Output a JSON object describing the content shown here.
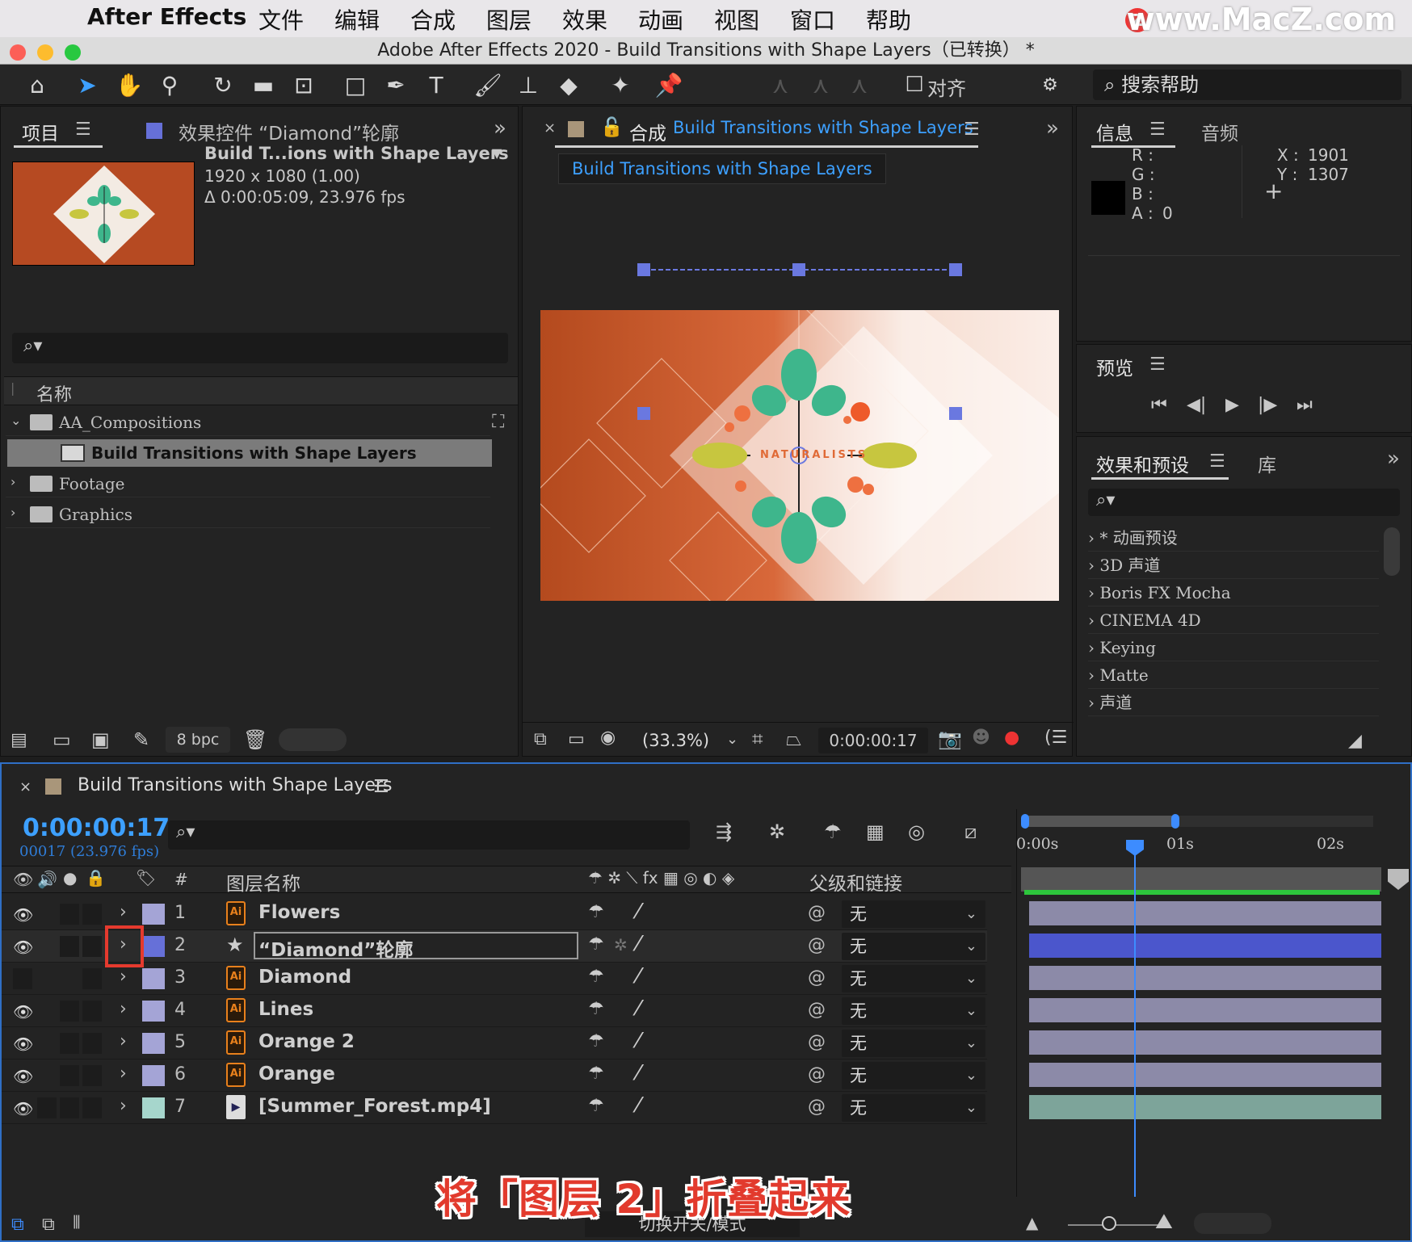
{
  "menubar": {
    "app_name": "After Effects",
    "items": [
      "文件",
      "编辑",
      "合成",
      "图层",
      "效果",
      "动画",
      "视图",
      "窗口",
      "帮助"
    ],
    "watermark": "www.MacZ.com",
    "watermark_badge": "Z"
  },
  "window": {
    "title": "Adobe After Effects 2020 - Build Transitions with Shape Layers（已转换） *"
  },
  "toolbar": {
    "align_label": "对齐",
    "search_help_placeholder": "搜索帮助"
  },
  "project_panel": {
    "tab_project": "项目",
    "tab_effect_controls": "效果控件 “Diamond”轮廓",
    "comp_name": "Build T...ions with Shape Layers",
    "resolution": "1920 x 1080 (1.00)",
    "duration": "Δ 0:00:05:09, 23.976 fps",
    "column_name": "名称",
    "items": [
      {
        "label": "AA_Compositions",
        "type": "folder",
        "expanded": true
      },
      {
        "label": "Build Transitions with Shape Layers",
        "type": "comp",
        "selected": true
      },
      {
        "label": "Footage",
        "type": "folder"
      },
      {
        "label": "Graphics",
        "type": "folder"
      }
    ],
    "bpc": "8 bpc"
  },
  "comp_panel": {
    "tab_prefix": "合成",
    "tab_name": "Build Transitions with Shape Layers",
    "name_tab": "Build Transitions with Shape Layers",
    "viewer_text": "NATURALISTS",
    "zoom": "(33.3%)",
    "timecode": "0:00:00:17"
  },
  "info_panel": {
    "tab_info": "信息",
    "tab_audio": "音频",
    "r_label": "R :",
    "g_label": "G :",
    "b_label": "B :",
    "a_label": "A :",
    "a_value": "0",
    "x_label": "X :",
    "x_value": "1901",
    "y_label": "Y :",
    "y_value": "1307"
  },
  "preview_panel": {
    "tab": "预览"
  },
  "effects_panel": {
    "tab_effects": "效果和预设",
    "tab_library": "库",
    "items": [
      "* 动画预设",
      "3D 声道",
      "Boris FX Mocha",
      "CINEMA 4D",
      "Keying",
      "Matte",
      "声道"
    ]
  },
  "timeline": {
    "tab_name": "Build Transitions with Shape Layers",
    "current_time": "0:00:00:17",
    "frame_fps": "00017 (23.976 fps)",
    "col_hash": "#",
    "col_layer_name": "图层名称",
    "col_parent": "父级和链接",
    "ruler": [
      "0:00s",
      "01s",
      "02s"
    ],
    "layers": [
      {
        "num": "1",
        "name": "Flowers",
        "kind": "ai",
        "color": "#a4a4d6",
        "parent": "无",
        "eye": true
      },
      {
        "num": "2",
        "name": "“Diamond”轮廓",
        "kind": "shape",
        "color": "#6670d8",
        "parent": "无",
        "eye": true,
        "selected": true
      },
      {
        "num": "3",
        "name": "Diamond",
        "kind": "ai",
        "color": "#a4a4d6",
        "parent": "无",
        "eye": false
      },
      {
        "num": "4",
        "name": "Lines",
        "kind": "ai",
        "color": "#a4a4d6",
        "parent": "无",
        "eye": true
      },
      {
        "num": "5",
        "name": "Orange 2",
        "kind": "ai",
        "color": "#a4a4d6",
        "parent": "无",
        "eye": true
      },
      {
        "num": "6",
        "name": "Orange",
        "kind": "ai",
        "color": "#a4a4d6",
        "parent": "无",
        "eye": true
      },
      {
        "num": "7",
        "name": "[Summer_Forest.mp4]",
        "kind": "footage",
        "color": "#a6d6cc",
        "parent": "无",
        "eye": true
      }
    ],
    "footer_label": "切换开关/模式"
  },
  "caption": "将「图层 2」折叠起来",
  "colors": {
    "accent_blue": "#3da0ff",
    "caption_red": "#e23a2d",
    "highlight_red": "#e53a2e"
  }
}
